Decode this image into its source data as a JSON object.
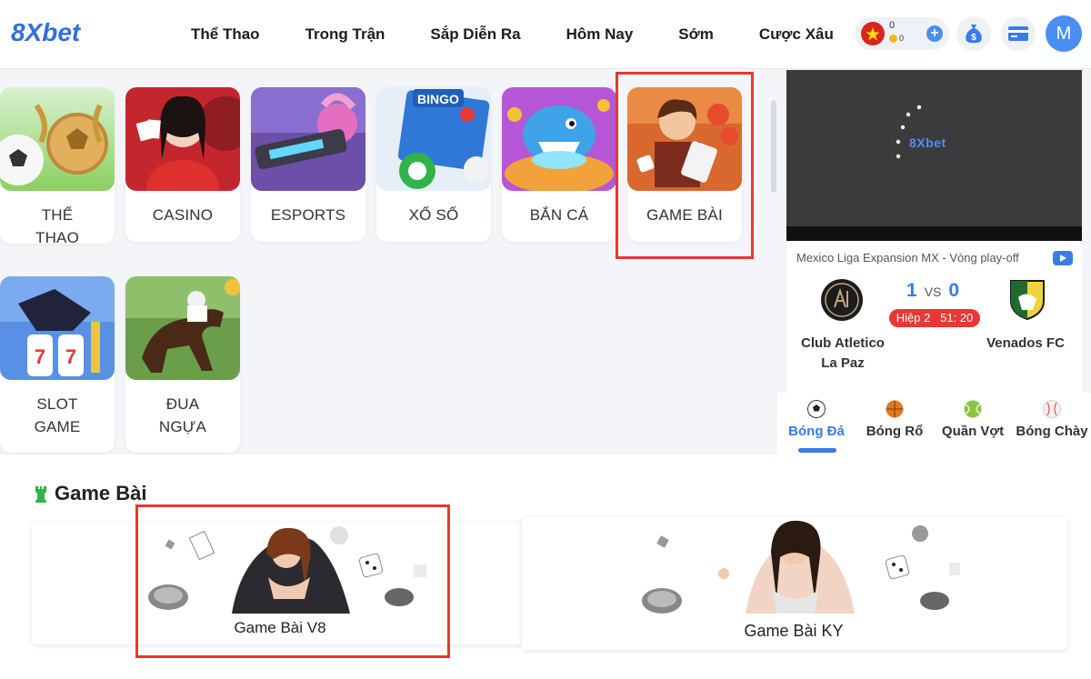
{
  "header": {
    "logo_text": "8Xbet",
    "nav": [
      "Thể Thao",
      "Trong Trận",
      "Sắp Diễn Ra",
      "Hôm Nay",
      "Sớm",
      "Cược Xâu"
    ],
    "balance_main": "0",
    "balance_coin": "0",
    "avatar_letter": "M"
  },
  "categories": [
    {
      "label": "THỂ\nTHAO"
    },
    {
      "label": "CASINO"
    },
    {
      "label": "ESPORTS"
    },
    {
      "label": "XỔ SỐ"
    },
    {
      "label": "BẮN CÁ"
    },
    {
      "label": "GAME BÀI"
    },
    {
      "label": "SLOT\nGAME"
    },
    {
      "label": "ĐUA\nNGỰA"
    }
  ],
  "bingo_text": "BINGO",
  "video": {
    "logo_text": "8Xbet"
  },
  "match": {
    "league": "Mexico Liga Expansion MX - Vòng play-off",
    "home_score": "1",
    "vs": "VS",
    "away_score": "0",
    "period": "Hiệp 2   51: 20",
    "home_line1": "Club Atletico",
    "home_line2": "La Paz",
    "away": "Venados FC"
  },
  "sports": [
    {
      "name": "Bóng Đá",
      "color": "#222222"
    },
    {
      "name": "Bóng Rổ",
      "color": "#e07a1f"
    },
    {
      "name": "Quần Vợt",
      "color": "#8cc63f"
    },
    {
      "name": "Bóng Chày",
      "color": "#e9e9e9"
    }
  ],
  "section": {
    "title": "Game Bài",
    "games": [
      {
        "label": "Game Bài V8"
      },
      {
        "label": "Game Bài KY"
      }
    ]
  },
  "colors": {
    "accent": "#3a7be8",
    "highlight": "#e53935"
  }
}
